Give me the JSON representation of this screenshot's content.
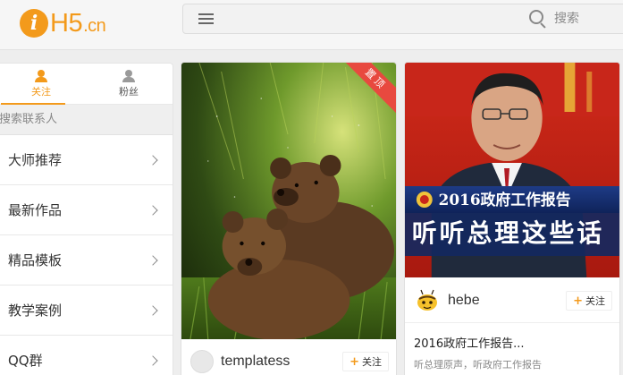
{
  "header": {
    "logo_letter": "i",
    "logo_text": "H5",
    "logo_suffix": ".cn",
    "search_placeholder": "搜索"
  },
  "sidebar": {
    "tabs": [
      {
        "label": "关注",
        "icon": "person-icon",
        "active": true
      },
      {
        "label": "粉丝",
        "icon": "person-icon",
        "active": false
      }
    ],
    "contact_search": "搜索联系人",
    "items": [
      {
        "label": "大师推荐"
      },
      {
        "label": "最新作品"
      },
      {
        "label": "精品模板"
      },
      {
        "label": "教学案例"
      },
      {
        "label": "QQ群"
      }
    ]
  },
  "cards": [
    {
      "ribbon": "置顶",
      "author": "templatess",
      "follow_label": "关注",
      "image": "two brown bear cubs in grass"
    },
    {
      "banner_title": "2016政府工作报告",
      "banner_subtitle": "听听总理这些话",
      "author": "hebe",
      "follow_label": "关注",
      "title": "2016政府工作报告...",
      "desc": "听总理原声，听政府工作报告"
    }
  ],
  "colors": {
    "accent": "#f39a1b",
    "ribbon": "#e8493f"
  }
}
